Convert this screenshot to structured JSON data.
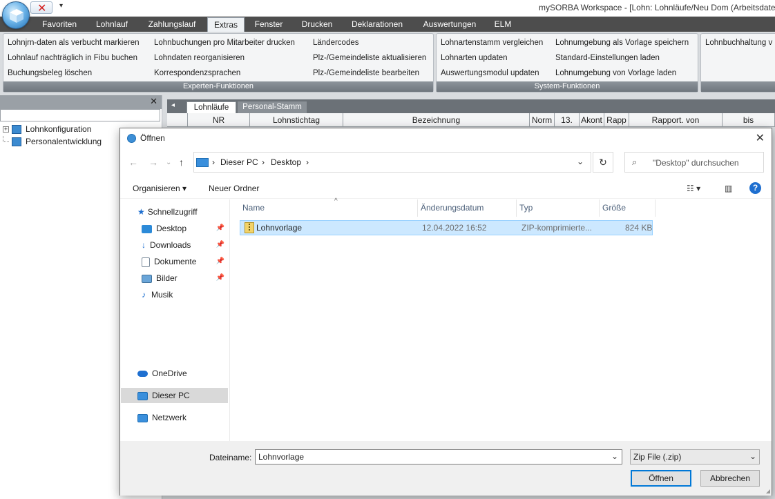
{
  "app": {
    "title": "mySORBA Workspace - [Lohn: Lohnläufe/Neu Dom (Arbeitsdaten",
    "menu_tabs": [
      "Favoriten",
      "Lohnlauf",
      "Zahlungslauf",
      "Extras",
      "Fenster",
      "Drucken",
      "Deklarationen",
      "Auswertungen",
      "ELM"
    ],
    "active_tab": "Extras"
  },
  "ribbon": {
    "expert_group": {
      "label": "Experten-Funktionen",
      "col1": [
        "Lohnjrn-daten als verbucht markieren",
        "Lohnlauf nachträglich in Fibu buchen",
        "Buchungsbeleg löschen"
      ],
      "col2": [
        "Lohnbuchungen pro Mitarbeiter drucken",
        "Lohndaten reorganisieren",
        "Korrespondenzsprachen"
      ],
      "col3": [
        "Ländercodes",
        "Plz-/Gemeindeliste aktualisieren",
        "Plz-/Gemeindeliste bearbeiten"
      ]
    },
    "system_group": {
      "label": "System-Funktionen",
      "col1": [
        "Lohnartenstamm vergleichen",
        "Lohnarten updaten",
        "Auswertungsmodul updaten"
      ],
      "col2": [
        "Lohnumgebung als Vorlage speichern",
        "Standard-Einstellungen laden",
        "Lohnumgebung von Vorlage laden"
      ]
    },
    "third_group": {
      "col1": [
        "Lohnbuchhaltung v"
      ]
    }
  },
  "tree": {
    "items": [
      {
        "label": "Lohnkonfiguration"
      },
      {
        "label": "Personalentwicklung"
      }
    ]
  },
  "document": {
    "tabs": [
      "Lohnläufe",
      "Personal-Stamm"
    ],
    "columns": [
      "NR",
      "Lohnstichtag",
      "Bezeichnung",
      "Norm",
      "13.",
      "Akont",
      "Rapp",
      "Rapport. von",
      "bis"
    ]
  },
  "dialog": {
    "title": "Öffnen",
    "address": [
      "Dieser PC",
      "Desktop"
    ],
    "search_placeholder": "\"Desktop\" durchsuchen",
    "cmd_organize": "Organisieren",
    "cmd_new_folder": "Neuer Ordner",
    "nav": {
      "quick_access": "Schnellzugriff",
      "quick_items": [
        "Desktop",
        "Downloads",
        "Dokumente",
        "Bilder",
        "Musik"
      ],
      "onedrive": "OneDrive",
      "this_pc": "Dieser PC",
      "network": "Netzwerk"
    },
    "columns": [
      "Name",
      "Änderungsdatum",
      "Typ",
      "Größe"
    ],
    "files": [
      {
        "name": "Lohnvorlage",
        "date": "12.04.2022 16:52",
        "type": "ZIP-komprimierte...",
        "size": "824 KB"
      }
    ],
    "filename_label": "Dateiname:",
    "filename_value": "Lohnvorlage",
    "filetype_value": "Zip File (.zip)",
    "open_button": "Öffnen",
    "cancel_button": "Abbrechen"
  }
}
